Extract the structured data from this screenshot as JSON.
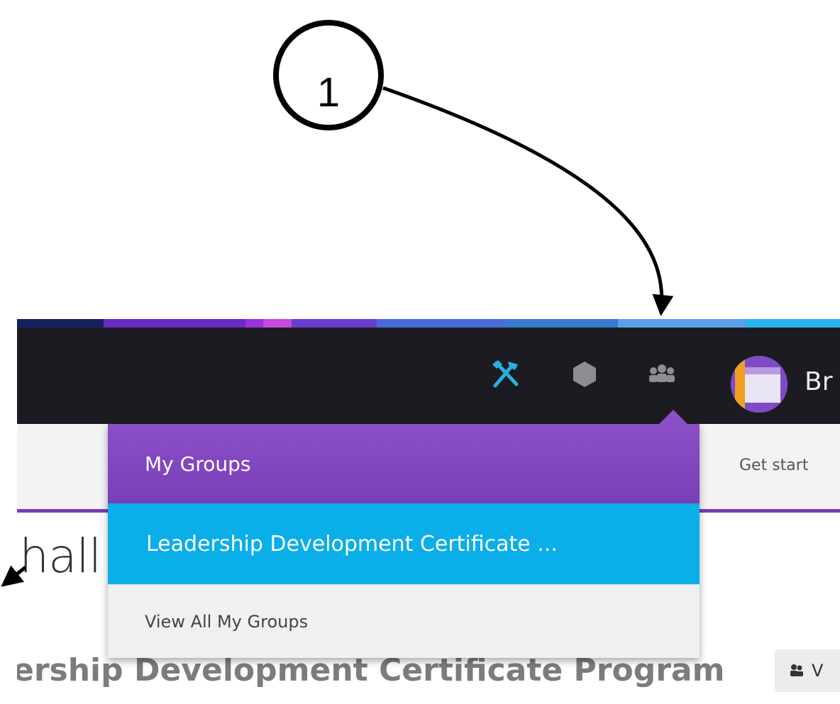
{
  "annotation": {
    "step_number": "1"
  },
  "colors": {
    "topbar": "#1c1b22",
    "accent_purple": "#8b4fc8",
    "active_blue": "#0aaee8",
    "tools_icon": "#29b0e0",
    "avatar_orange": "#f0a020"
  },
  "color_strip": [
    "#17205e",
    "#6a2bc4",
    "#9a30e0",
    "#c44bdc",
    "#6b3ed0",
    "#4a6ad8",
    "#3a78d0",
    "#5aa0e8",
    "#2bb2f0"
  ],
  "topbar": {
    "icons": [
      "tools-icon",
      "hexagon-icon",
      "groups-icon"
    ],
    "user_name": "Br"
  },
  "subbar": {
    "link_text": "Get start"
  },
  "dropdown": {
    "header": "My Groups",
    "items": [
      "Leadership Development Certificate ..."
    ],
    "footer": "View All My Groups"
  },
  "page": {
    "heading_partial": ":hall",
    "program_title": "ership Development Certificate Program",
    "view_button_label": "V"
  }
}
